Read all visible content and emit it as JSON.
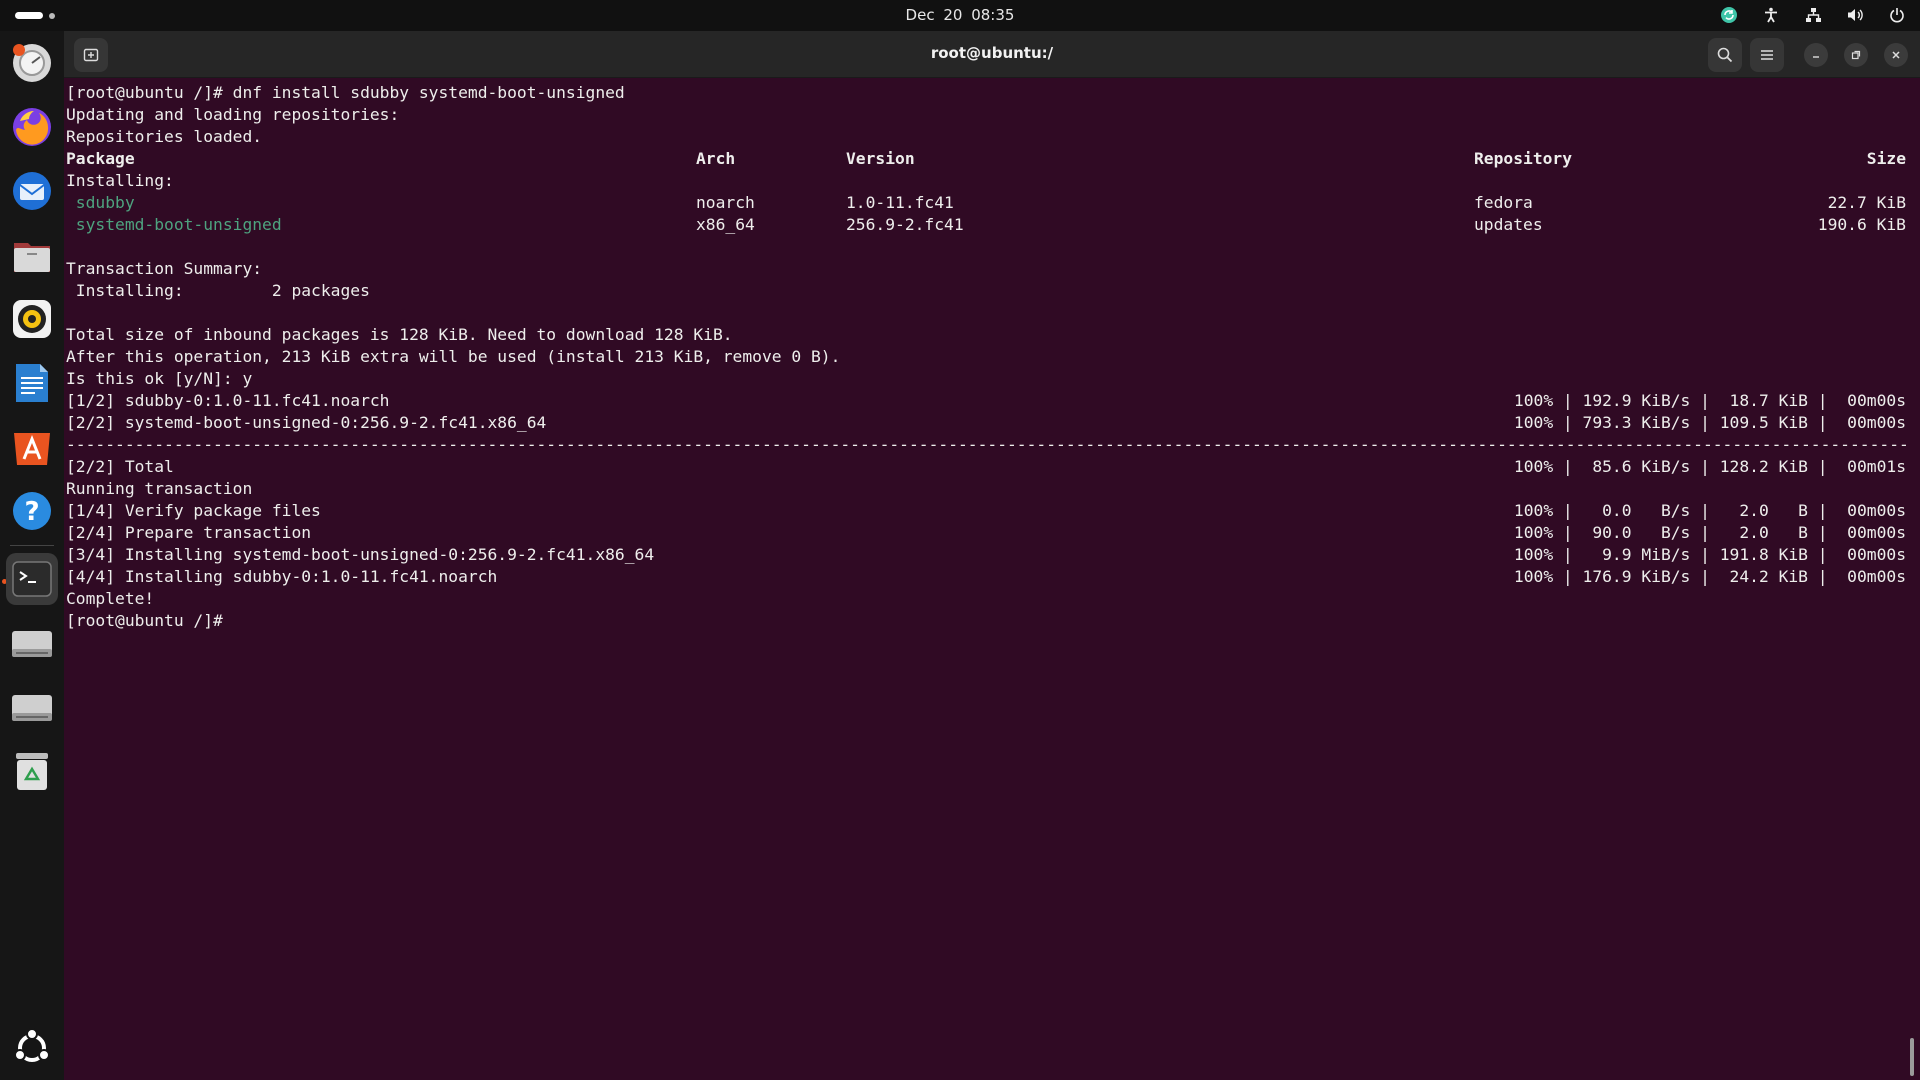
{
  "topbar": {
    "datetime": "Dec 20  08:35",
    "tray_icons": [
      "update-icon",
      "accessibility-icon",
      "network-icon",
      "volume-icon",
      "power-icon"
    ]
  },
  "dock": {
    "items": [
      "ubuntu-help-icon",
      "firefox-icon",
      "thunderbird-icon",
      "files-icon",
      "rhythmbox-icon",
      "libreoffice-writer-icon",
      "app-center-icon",
      "help-icon",
      "terminal-icon",
      "drive-icon",
      "drive-icon",
      "trash-icon"
    ],
    "bottom": "show-apps-icon"
  },
  "window": {
    "title": "root@ubuntu:/"
  },
  "terminal": {
    "lines": [
      {
        "text": "[root@ubuntu /]# dnf install sdubby systemd-boot-unsigned"
      },
      {
        "text": "Updating and loading repositories:"
      },
      {
        "text": "Repositories loaded."
      },
      {
        "cols": [
          "Package",
          "Arch",
          "Version",
          "Repository",
          "Size"
        ],
        "bold": true
      },
      {
        "text": "Installing:"
      },
      {
        "cols": [
          " sdubby",
          "noarch",
          "1.0-11.fc41",
          "fedora",
          "22.7 KiB"
        ],
        "green": true
      },
      {
        "cols": [
          " systemd-boot-unsigned",
          "x86_64",
          "256.9-2.fc41",
          "updates",
          "190.6 KiB"
        ],
        "green": true
      },
      {
        "text": ""
      },
      {
        "text": "Transaction Summary:"
      },
      {
        "text": " Installing:         2 packages"
      },
      {
        "text": ""
      },
      {
        "text": "Total size of inbound packages is 128 KiB. Need to download 128 KiB."
      },
      {
        "text": "After this operation, 213 KiB extra will be used (install 213 KiB, remove 0 B)."
      },
      {
        "text": "Is this ok [y/N]: y"
      },
      {
        "left": "[1/2] sdubby-0:1.0-11.fc41.noarch",
        "right": "100% | 192.9 KiB/s |  18.7 KiB |  00m00s"
      },
      {
        "left": "[2/2] systemd-boot-unsigned-0:256.9-2.fc41.x86_64",
        "right": "100% | 793.3 KiB/s | 109.5 KiB |  00m00s"
      },
      {
        "divider": "--------------------------------------------------------------------------------------------------------------------------------------------------------------------------------------------------------------"
      },
      {
        "left": "[2/2] Total",
        "right": "100% |  85.6 KiB/s | 128.2 KiB |  00m01s"
      },
      {
        "text": "Running transaction"
      },
      {
        "left": "[1/4] Verify package files",
        "right": "100% |   0.0   B/s |   2.0   B |  00m00s"
      },
      {
        "left": "[2/4] Prepare transaction",
        "right": "100% |  90.0   B/s |   2.0   B |  00m00s"
      },
      {
        "left": "[3/4] Installing systemd-boot-unsigned-0:256.9-2.fc41.x86_64",
        "right": "100% |   9.9 MiB/s | 191.8 KiB |  00m00s"
      },
      {
        "left": "[4/4] Installing sdubby-0:1.0-11.fc41.noarch",
        "right": "100% | 176.9 KiB/s |  24.2 KiB |  00m00s"
      },
      {
        "text": "Complete!"
      },
      {
        "text": "[root@ubuntu /]# "
      }
    ]
  }
}
